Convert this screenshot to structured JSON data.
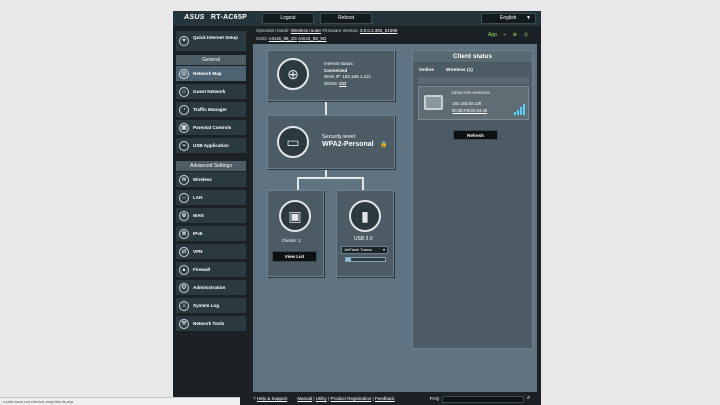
{
  "header": {
    "brand": "ASUS",
    "model": "RT-AC65P",
    "logout_label": "Logout",
    "reboot_label": "Reboot",
    "language": "English"
  },
  "info": {
    "op_mode_label": "Operation Mode:",
    "op_mode_value": "Wireless router",
    "fw_label": "Firmware Version:",
    "fw_value": "3.0.0.4.382_51599",
    "ssid_label": "SSID:",
    "ssid_1": "ASUS_88_2G",
    "ssid_2": "ASUS_88_5G",
    "app_label": "App"
  },
  "sidebar": {
    "quick_setup": "Quick Internet Setup",
    "general_title": "General",
    "general_items": [
      {
        "label": "Network Map"
      },
      {
        "label": "Guest Network"
      },
      {
        "label": "Traffic Manager"
      },
      {
        "label": "Parental Controls"
      },
      {
        "label": "USB Application"
      }
    ],
    "advanced_title": "Advanced Settings",
    "advanced_items": [
      {
        "label": "Wireless"
      },
      {
        "label": "LAN"
      },
      {
        "label": "WAN"
      },
      {
        "label": "IPv6"
      },
      {
        "label": "VPN"
      },
      {
        "label": "Firewall"
      },
      {
        "label": "Administration"
      },
      {
        "label": "System Log"
      },
      {
        "label": "Network Tools"
      }
    ]
  },
  "internet": {
    "status_label": "Internet status:",
    "status_value": "Connected",
    "wan_ip_label": "WAN IP:",
    "wan_ip_value": "192.168.1.112",
    "ddns_label": "DDNS:",
    "ddns_value": "GO"
  },
  "security": {
    "level_label": "Security level:",
    "level_value": "WPA2-Personal"
  },
  "clients": {
    "label": "Clients:",
    "count": "1",
    "view_list": "View List"
  },
  "usb": {
    "label": "USB 3.0",
    "device": "JetFlash Transc",
    "usage_fraction": 0.12
  },
  "client_status": {
    "title": "Client status",
    "tab_online": "Online",
    "tab_wireless": "Wireless (1)",
    "device_name": "DESKTOP-9HS0D94",
    "device_ip": "192.168.50.139",
    "device_mac": "00:3E:F8:D2:04:48",
    "refresh_label": "Refresh"
  },
  "footer": {
    "help": "Help & Support",
    "manual": "Manual",
    "utility": "Utility",
    "product_registration": "Product Registration",
    "feedback": "Feedback",
    "faq": "FAQ",
    "status_url": "router.asus.com/device-map/clients.asp"
  }
}
